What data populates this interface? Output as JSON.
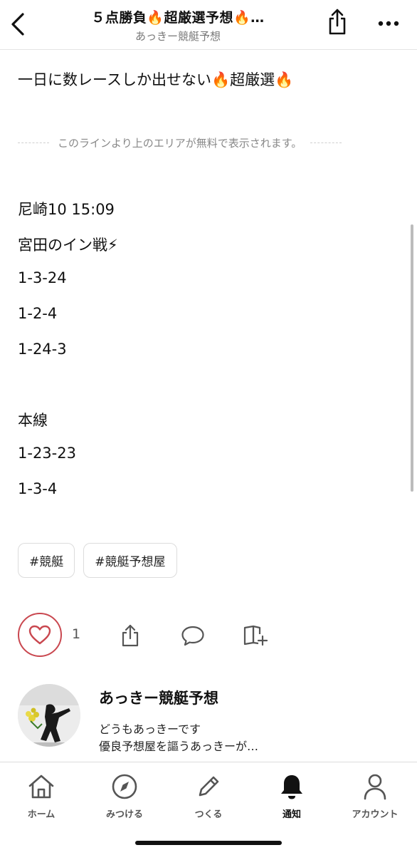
{
  "header": {
    "title": "５点勝負🔥超厳選予想🔥…",
    "subtitle": "あっきー競艇予想"
  },
  "article": {
    "lead": "一日に数レースしか出せない🔥超厳選🔥",
    "paywall_notice": "このラインより上のエリアが無料で表示されます。",
    "lines": [
      "尼崎10 15:09",
      "宮田のイン戦⚡",
      "1-3-24",
      "1-2-4",
      "1-24-3",
      "本線",
      "1-23-23",
      "1-3-4"
    ],
    "tags": [
      "#競艇",
      "#競艇予想屋"
    ]
  },
  "actions": {
    "like_count": "1"
  },
  "author": {
    "name": "あっきー競艇予想",
    "bio_line1": "どうもあっきーです",
    "bio_line2": "優良予想屋を謳うあっきーが…"
  },
  "tabbar": {
    "items": [
      {
        "label": "ホーム",
        "icon": "home-icon"
      },
      {
        "label": "みつける",
        "icon": "compass-icon"
      },
      {
        "label": "つくる",
        "icon": "pencil-icon"
      },
      {
        "label": "通知",
        "icon": "bell-icon"
      },
      {
        "label": "アカウント",
        "icon": "person-icon"
      }
    ],
    "active_index": 3
  },
  "colors": {
    "accent_like": "#c9474f",
    "text": "#111111",
    "muted": "#777777"
  }
}
